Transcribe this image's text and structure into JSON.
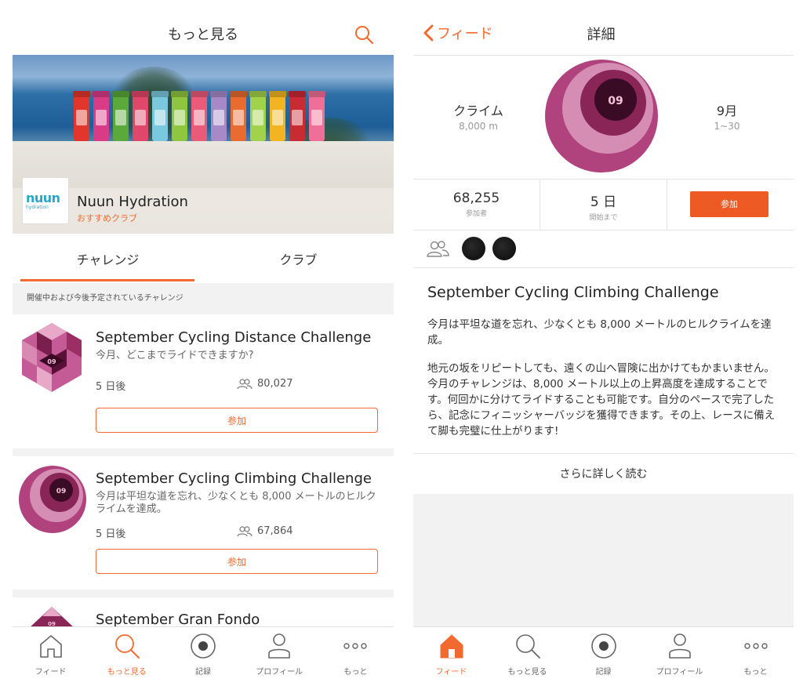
{
  "colors": {
    "accent": "#f26a2e",
    "join_filled": "#ee5a24"
  },
  "left": {
    "header": {
      "title": "もっと見る",
      "search_icon": "search-icon"
    },
    "hero": {
      "logo_word": "nuun",
      "logo_sub": "hydration",
      "club_name": "Nuun Hydration",
      "club_tag": "おすすめクラブ"
    },
    "tabs": [
      {
        "label": "チャレンジ",
        "active": true
      },
      {
        "label": "クラブ",
        "active": false
      }
    ],
    "section_label": "開催中および今後予定されているチャレンジ",
    "challenges": [
      {
        "title": "September Cycling Distance Challenge",
        "desc": "今月、どこまでライドできますか?",
        "date": "5 日後",
        "count": "80,027",
        "join": "参加",
        "badge_text": "09"
      },
      {
        "title": "September Cycling Climbing Challenge",
        "desc": "今月は平坦な道を忘れ、少なくとも 8,000 メートルのヒルクライムを達成。",
        "date": "5 日後",
        "count": "67,864",
        "join": "参加",
        "badge_text": "09"
      },
      {
        "title": "September Gran Fondo",
        "badge_text": "09"
      }
    ],
    "tabbar": [
      {
        "label": "フィード",
        "icon": "home-icon",
        "active": false
      },
      {
        "label": "もっと見る",
        "icon": "search-icon",
        "active": true
      },
      {
        "label": "記録",
        "icon": "record-icon",
        "active": false
      },
      {
        "label": "プロフィール",
        "icon": "profile-icon",
        "active": false
      },
      {
        "label": "もっと",
        "icon": "more-icon",
        "active": false
      }
    ]
  },
  "right": {
    "header": {
      "back_label": "フィード",
      "title": "詳細"
    },
    "goal": {
      "label": "クライム",
      "value": "8,000 m"
    },
    "period": {
      "label": "9月",
      "value": "1~30"
    },
    "badge_text": "09",
    "stats": {
      "participants": {
        "value": "68,255",
        "label": "参加者"
      },
      "starts_in": {
        "value": "5 日",
        "label": "開始まで"
      },
      "join": "参加"
    },
    "title": "September Cycling Climbing Challenge",
    "para1": "今月は平坦な道を忘れ、少なくとも 8,000 メートルのヒルクライムを達成。",
    "para2": "地元の坂をリピートしても、遠くの山へ冒険に出かけてもかまいません。今月のチャレンジは、8,000 メートル以上の上昇高度を達成することです。何回かに分けてライドすることも可能です。自分のペースで完了したら、記念にフィニッシャーバッジを獲得できます。その上、レースに備えて脚も完璧に仕上がります!",
    "read_more": "さらに詳しく読む",
    "tabbar": [
      {
        "label": "フィード",
        "icon": "home-icon",
        "active": true
      },
      {
        "label": "もっと見る",
        "icon": "search-icon",
        "active": false
      },
      {
        "label": "記録",
        "icon": "record-icon",
        "active": false
      },
      {
        "label": "プロフィール",
        "icon": "profile-icon",
        "active": false
      },
      {
        "label": "もっと",
        "icon": "more-icon",
        "active": false
      }
    ]
  }
}
